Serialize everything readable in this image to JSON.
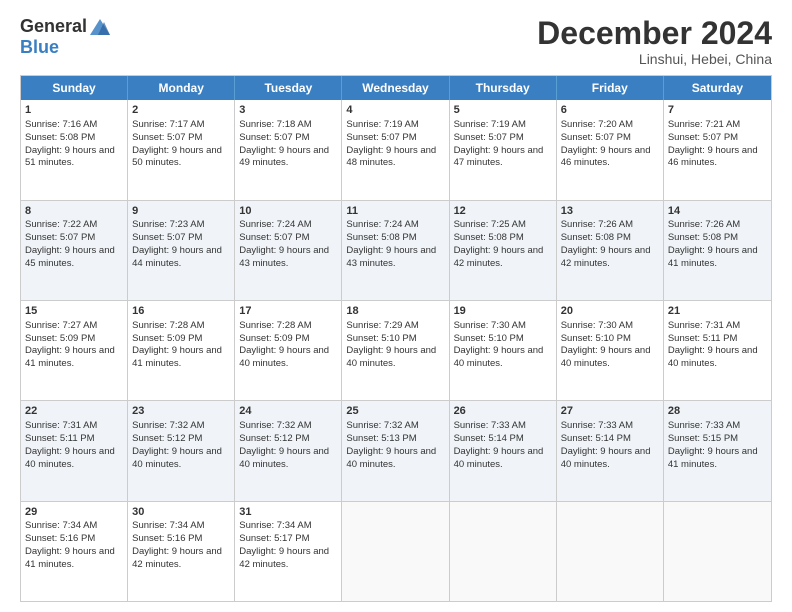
{
  "header": {
    "logo_general": "General",
    "logo_blue": "Blue",
    "month_title": "December 2024",
    "location": "Linshui, Hebei, China"
  },
  "days": [
    "Sunday",
    "Monday",
    "Tuesday",
    "Wednesday",
    "Thursday",
    "Friday",
    "Saturday"
  ],
  "weeks": [
    [
      {
        "day": "1",
        "sunrise": "7:16 AM",
        "sunset": "5:08 PM",
        "daylight": "9 hours and 51 minutes."
      },
      {
        "day": "2",
        "sunrise": "7:17 AM",
        "sunset": "5:07 PM",
        "daylight": "9 hours and 50 minutes."
      },
      {
        "day": "3",
        "sunrise": "7:18 AM",
        "sunset": "5:07 PM",
        "daylight": "9 hours and 49 minutes."
      },
      {
        "day": "4",
        "sunrise": "7:19 AM",
        "sunset": "5:07 PM",
        "daylight": "9 hours and 48 minutes."
      },
      {
        "day": "5",
        "sunrise": "7:19 AM",
        "sunset": "5:07 PM",
        "daylight": "9 hours and 47 minutes."
      },
      {
        "day": "6",
        "sunrise": "7:20 AM",
        "sunset": "5:07 PM",
        "daylight": "9 hours and 46 minutes."
      },
      {
        "day": "7",
        "sunrise": "7:21 AM",
        "sunset": "5:07 PM",
        "daylight": "9 hours and 46 minutes."
      }
    ],
    [
      {
        "day": "8",
        "sunrise": "7:22 AM",
        "sunset": "5:07 PM",
        "daylight": "9 hours and 45 minutes."
      },
      {
        "day": "9",
        "sunrise": "7:23 AM",
        "sunset": "5:07 PM",
        "daylight": "9 hours and 44 minutes."
      },
      {
        "day": "10",
        "sunrise": "7:24 AM",
        "sunset": "5:07 PM",
        "daylight": "9 hours and 43 minutes."
      },
      {
        "day": "11",
        "sunrise": "7:24 AM",
        "sunset": "5:08 PM",
        "daylight": "9 hours and 43 minutes."
      },
      {
        "day": "12",
        "sunrise": "7:25 AM",
        "sunset": "5:08 PM",
        "daylight": "9 hours and 42 minutes."
      },
      {
        "day": "13",
        "sunrise": "7:26 AM",
        "sunset": "5:08 PM",
        "daylight": "9 hours and 42 minutes."
      },
      {
        "day": "14",
        "sunrise": "7:26 AM",
        "sunset": "5:08 PM",
        "daylight": "9 hours and 41 minutes."
      }
    ],
    [
      {
        "day": "15",
        "sunrise": "7:27 AM",
        "sunset": "5:09 PM",
        "daylight": "9 hours and 41 minutes."
      },
      {
        "day": "16",
        "sunrise": "7:28 AM",
        "sunset": "5:09 PM",
        "daylight": "9 hours and 41 minutes."
      },
      {
        "day": "17",
        "sunrise": "7:28 AM",
        "sunset": "5:09 PM",
        "daylight": "9 hours and 40 minutes."
      },
      {
        "day": "18",
        "sunrise": "7:29 AM",
        "sunset": "5:10 PM",
        "daylight": "9 hours and 40 minutes."
      },
      {
        "day": "19",
        "sunrise": "7:30 AM",
        "sunset": "5:10 PM",
        "daylight": "9 hours and 40 minutes."
      },
      {
        "day": "20",
        "sunrise": "7:30 AM",
        "sunset": "5:10 PM",
        "daylight": "9 hours and 40 minutes."
      },
      {
        "day": "21",
        "sunrise": "7:31 AM",
        "sunset": "5:11 PM",
        "daylight": "9 hours and 40 minutes."
      }
    ],
    [
      {
        "day": "22",
        "sunrise": "7:31 AM",
        "sunset": "5:11 PM",
        "daylight": "9 hours and 40 minutes."
      },
      {
        "day": "23",
        "sunrise": "7:32 AM",
        "sunset": "5:12 PM",
        "daylight": "9 hours and 40 minutes."
      },
      {
        "day": "24",
        "sunrise": "7:32 AM",
        "sunset": "5:12 PM",
        "daylight": "9 hours and 40 minutes."
      },
      {
        "day": "25",
        "sunrise": "7:32 AM",
        "sunset": "5:13 PM",
        "daylight": "9 hours and 40 minutes."
      },
      {
        "day": "26",
        "sunrise": "7:33 AM",
        "sunset": "5:14 PM",
        "daylight": "9 hours and 40 minutes."
      },
      {
        "day": "27",
        "sunrise": "7:33 AM",
        "sunset": "5:14 PM",
        "daylight": "9 hours and 40 minutes."
      },
      {
        "day": "28",
        "sunrise": "7:33 AM",
        "sunset": "5:15 PM",
        "daylight": "9 hours and 41 minutes."
      }
    ],
    [
      {
        "day": "29",
        "sunrise": "7:34 AM",
        "sunset": "5:16 PM",
        "daylight": "9 hours and 41 minutes."
      },
      {
        "day": "30",
        "sunrise": "7:34 AM",
        "sunset": "5:16 PM",
        "daylight": "9 hours and 42 minutes."
      },
      {
        "day": "31",
        "sunrise": "7:34 AM",
        "sunset": "5:17 PM",
        "daylight": "9 hours and 42 minutes."
      },
      null,
      null,
      null,
      null
    ]
  ]
}
